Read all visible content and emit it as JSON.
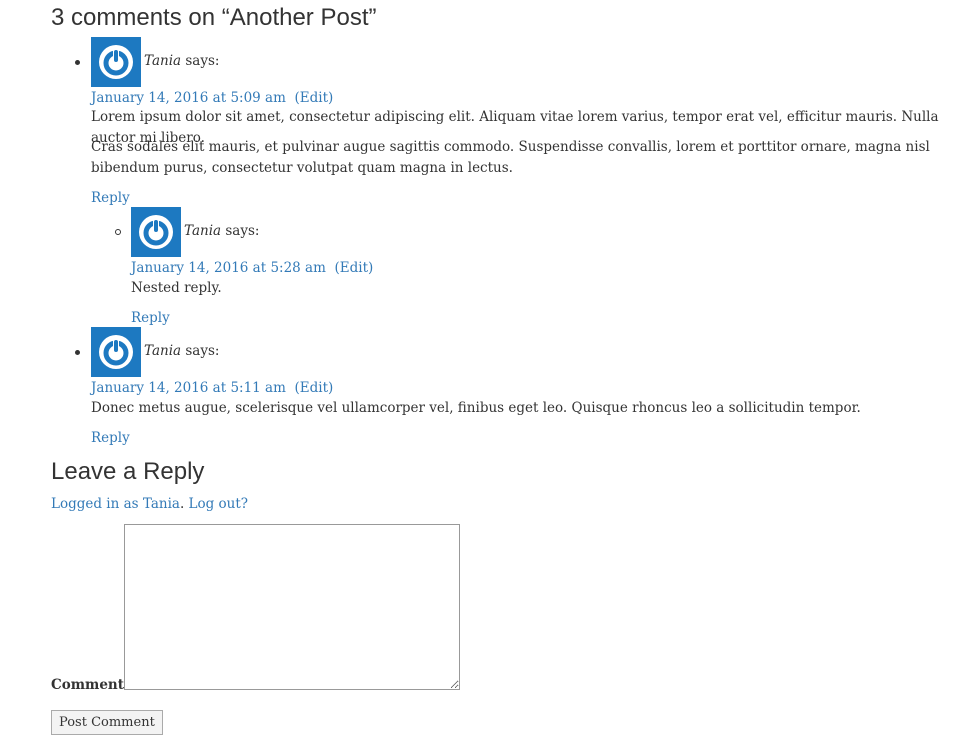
{
  "comments_section": {
    "title": "3 comments on “Another Post”",
    "comments": [
      {
        "author": "Tania",
        "says": " says:",
        "date": "January 14, 2016 at 5:09 am",
        "edit": "(Edit)",
        "paragraphs": [
          "Lorem ipsum dolor sit amet, consectetur adipiscing elit. Aliquam vitae lorem varius, tempor erat vel, efficitur mauris. Nulla auctor mi libero.",
          "Cras sodales elit mauris, et pulvinar augue sagittis commodo. Suspendisse convallis, lorem et porttitor ornare, magna nisl bibendum purus, consectetur volutpat quam magna in lectus."
        ],
        "reply": "Reply"
      },
      {
        "author": "Tania",
        "says": " says:",
        "date": "January 14, 2016 at 5:28 am",
        "edit": "(Edit)",
        "paragraphs": [
          "Nested reply."
        ],
        "reply": "Reply"
      },
      {
        "author": "Tania",
        "says": " says:",
        "date": "January 14, 2016 at 5:11 am",
        "edit": "(Edit)",
        "paragraphs": [
          "Donec metus augue, scelerisque vel ullamcorper vel, finibus eget leo. Quisque rhoncus leo a sollicitudin tempor."
        ],
        "reply": "Reply"
      }
    ]
  },
  "reply_form": {
    "title": "Leave a Reply",
    "logged_in_text": "Logged in as Tania",
    "logout_text": "Log out?",
    "comment_label": "Comment",
    "comment_value": "",
    "submit_label": "Post Comment"
  },
  "colors": {
    "link": "#337ab7",
    "avatar_bg": "#1d79c1",
    "text": "#333333"
  },
  "icons": {
    "avatar": "power-icon"
  }
}
